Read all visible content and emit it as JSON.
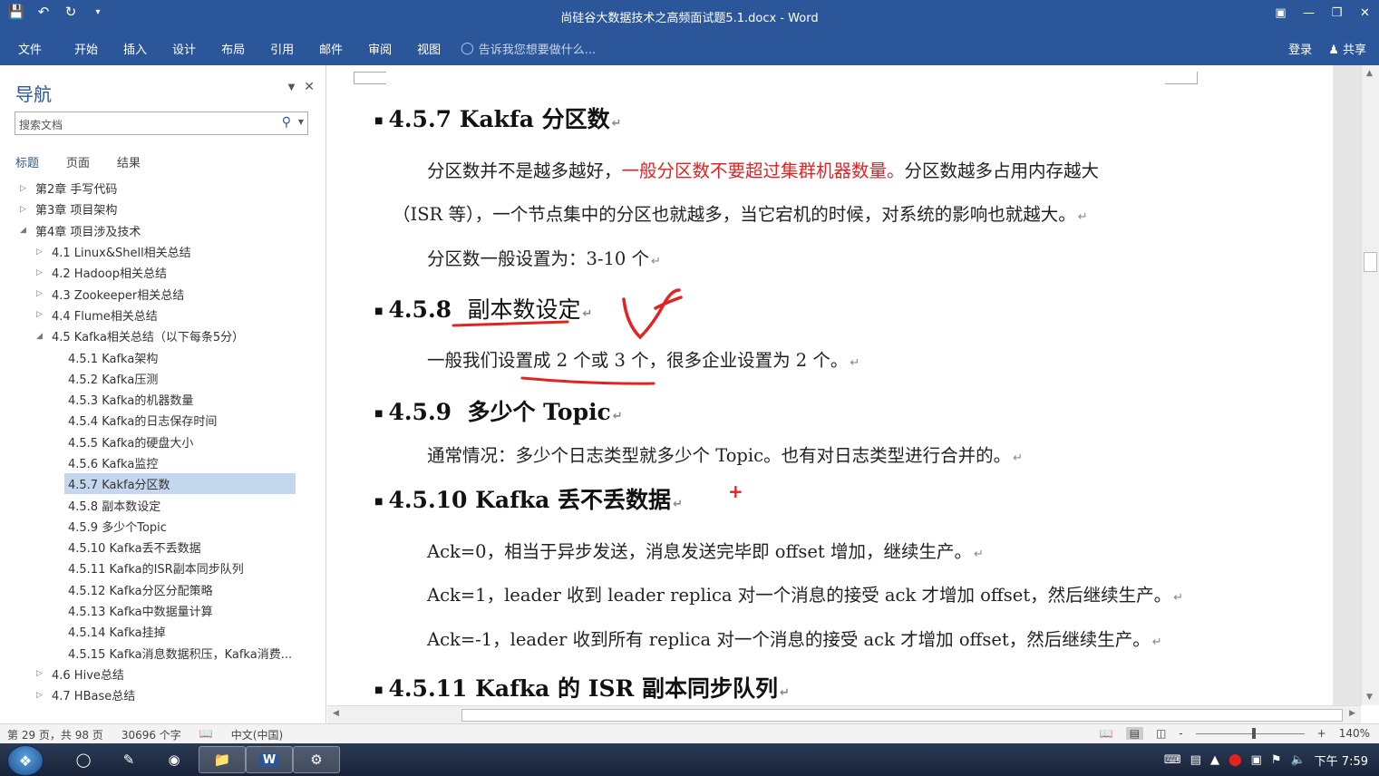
{
  "window": {
    "title": "尚硅谷大数据技术之高频面试题5.1.docx - Word",
    "qat_icons": [
      "save-icon",
      "undo-icon",
      "redo-icon",
      "customize-icon"
    ],
    "controls": [
      "ribbon-display-icon",
      "minimize-icon",
      "restore-icon",
      "close-icon"
    ]
  },
  "ribbon": {
    "tabs": [
      "文件",
      "开始",
      "插入",
      "设计",
      "布局",
      "引用",
      "邮件",
      "审阅",
      "视图"
    ],
    "tell_me": "告诉我您想要做什么...",
    "signin": "登录",
    "share": "共享"
  },
  "nav": {
    "title": "导航",
    "search_placeholder": "搜索文档",
    "subtabs": [
      "标题",
      "页面",
      "结果"
    ],
    "active_subtab": "标题",
    "items": [
      {
        "label": "第2章 手写代码",
        "level": 0,
        "arrow": "▷"
      },
      {
        "label": "第3章 项目架构",
        "level": 0,
        "arrow": "▷"
      },
      {
        "label": "第4章 项目涉及技术",
        "level": 0,
        "arrow": "◢"
      },
      {
        "label": "4.1 Linux&Shell相关总结",
        "level": 1,
        "arrow": "▷"
      },
      {
        "label": "4.2 Hadoop相关总结",
        "level": 1,
        "arrow": "▷"
      },
      {
        "label": "4.3 Zookeeper相关总结",
        "level": 1,
        "arrow": "▷"
      },
      {
        "label": "4.4 Flume相关总结",
        "level": 1,
        "arrow": "▷"
      },
      {
        "label": "4.5 Kafka相关总结（以下每条5分）",
        "level": 1,
        "arrow": "◢"
      },
      {
        "label": "4.5.1 Kafka架构",
        "level": 2,
        "arrow": ""
      },
      {
        "label": "4.5.2 Kafka压测",
        "level": 2,
        "arrow": ""
      },
      {
        "label": "4.5.3 Kafka的机器数量",
        "level": 2,
        "arrow": ""
      },
      {
        "label": "4.5.4 Kafka的日志保存时间",
        "level": 2,
        "arrow": ""
      },
      {
        "label": "4.5.5 Kafka的硬盘大小",
        "level": 2,
        "arrow": ""
      },
      {
        "label": "4.5.6 Kafka监控",
        "level": 2,
        "arrow": ""
      },
      {
        "label": "4.5.7 Kakfa分区数",
        "level": 2,
        "arrow": "",
        "selected": true
      },
      {
        "label": "4.5.8 副本数设定",
        "level": 2,
        "arrow": ""
      },
      {
        "label": "4.5.9 多少个Topic",
        "level": 2,
        "arrow": ""
      },
      {
        "label": "4.5.10 Kafka丢不丢数据",
        "level": 2,
        "arrow": ""
      },
      {
        "label": "4.5.11 Kafka的ISR副本同步队列",
        "level": 2,
        "arrow": ""
      },
      {
        "label": "4.5.12 Kafka分区分配策略",
        "level": 2,
        "arrow": ""
      },
      {
        "label": "4.5.13 Kafka中数据量计算",
        "level": 2,
        "arrow": ""
      },
      {
        "label": "4.5.14 Kafka挂掉",
        "level": 2,
        "arrow": ""
      },
      {
        "label": "4.5.15 Kafka消息数据积压，Kafka消费...",
        "level": 2,
        "arrow": ""
      },
      {
        "label": "4.6 Hive总结",
        "level": 1,
        "arrow": "▷"
      },
      {
        "label": "4.7 HBase总结",
        "level": 1,
        "arrow": "▷"
      }
    ]
  },
  "doc": {
    "h457": "4.5.7 Kakfa 分区数",
    "p1_a": "分区数并不是越多越好，",
    "p1_red": "一般分区数不要超过集群机器数量。",
    "p1_b": "分区数越多占用内存越大",
    "p2": "（ISR 等），一个节点集中的分区也就越多，当它宕机的时候，对系统的影响也就越大。",
    "p3": "分区数一般设置为：3-10 个",
    "h458_num": "4.5.8",
    "h458_text": "副本数设定",
    "p4": "一般我们设置成 2 个或 3 个，很多企业设置为 2 个。",
    "h459_num": "4.5.9",
    "h459_text": "多少个 Topic",
    "p5": "通常情况：多少个日志类型就多少个 Topic。也有对日志类型进行合并的。",
    "h4510": "4.5.10 Kafka 丢不丢数据",
    "p6": "Ack=0，相当于异步发送，消息发送完毕即 offset 增加，继续生产。",
    "p7": "Ack=1，leader 收到 leader replica  对一个消息的接受 ack 才增加 offset，然后继续生产。",
    "p8": "Ack=-1，leader 收到所有 replica  对一个消息的接受 ack 才增加 offset，然后继续生产。",
    "h4511": "4.5.11 Kafka 的 ISR 副本同步队列",
    "para_mark": "↵",
    "bullet": "■",
    "cursor_glyph": "+",
    "annotation_color": "#e32222"
  },
  "status": {
    "page": "第 29 页，共 98 页",
    "words": "30696 个字",
    "lang": "中文(中国)",
    "zoom": "140%",
    "zoom_minus": "-",
    "zoom_plus": "+"
  },
  "taskbar": {
    "time": "下午 7:59",
    "apps": [
      "start-orb",
      "ie-icon",
      "notepad-icon",
      "chrome-icon",
      "explorer-icon",
      "word-icon",
      "app-icon"
    ]
  }
}
